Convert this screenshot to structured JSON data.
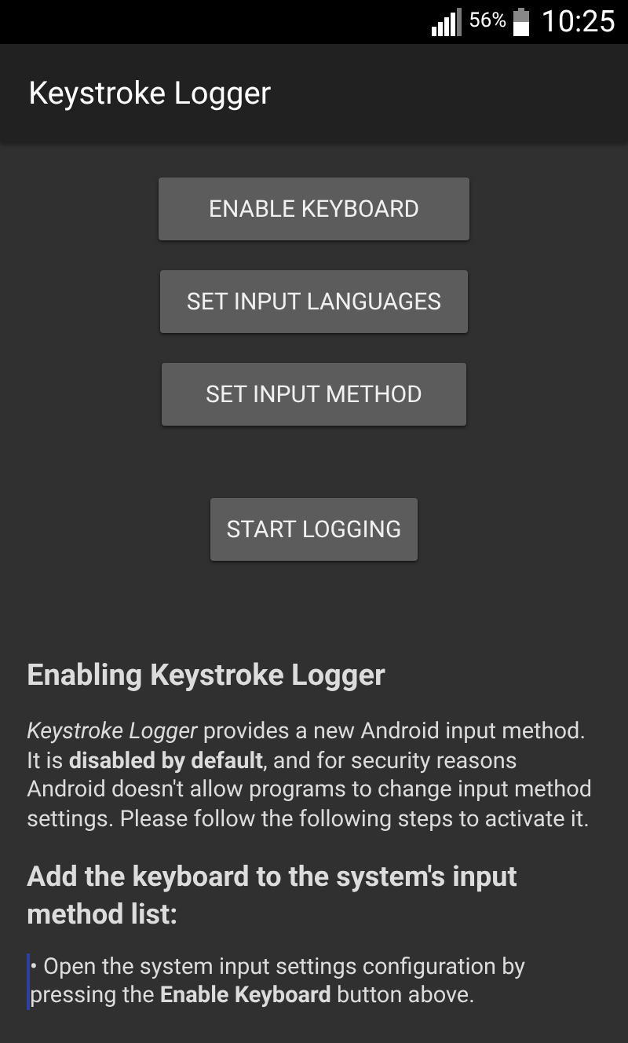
{
  "status_bar": {
    "battery": "56%",
    "time": "10:25"
  },
  "app_bar": {
    "title": "Keystroke Logger"
  },
  "buttons": [
    {
      "label": "ENABLE KEYBOARD"
    },
    {
      "label": "SET INPUT LANGUAGES"
    },
    {
      "label": "SET INPUT METHOD"
    },
    {
      "label": "START LOGGING"
    }
  ],
  "help": {
    "title": "Enabling Keystroke Logger",
    "intro": "*Keystroke Logger* provides a new Android input method. It is **disabled by default**, and for security reasons Android doesn't allow programs to change input method settings. Please follow the following steps to activate it.",
    "step_title": "Add the keyboard to the system's input method list:",
    "steps": [
      "• Open the system input settings configuration by pressing the **Enable Keyboard** button above."
    ]
  }
}
